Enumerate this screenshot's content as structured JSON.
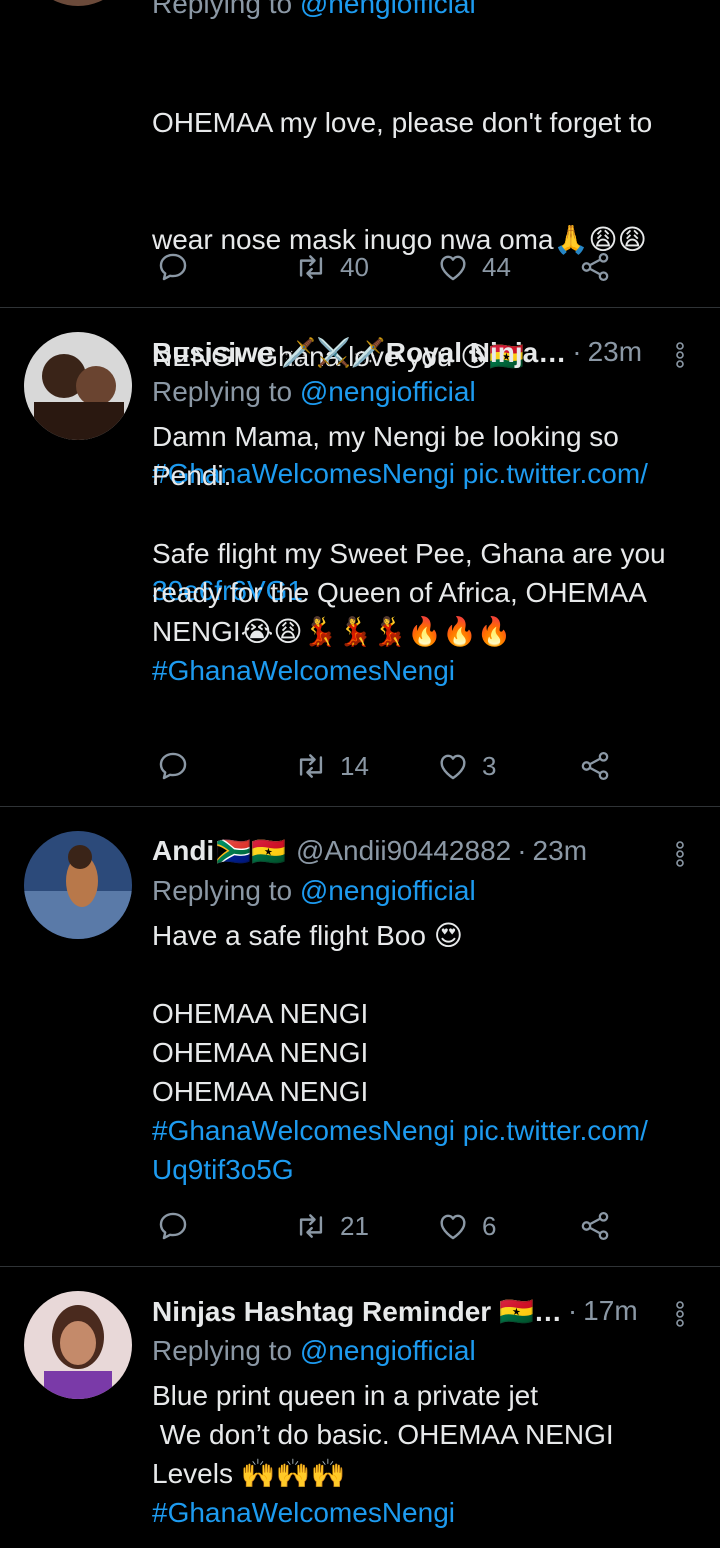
{
  "tweets": [
    {
      "reply_prefix": "Replying to ",
      "reply_handle": "@nengiofficial",
      "line1": "OHEMAA my love, please don't forget to",
      "line2": "wear nose mask inugo nwa oma🙏😩😩",
      "line3": "NENGI  Ghana love you 😘🇬🇭",
      "line4": "#GhanaWelcomesNengi pic.twitter.com/",
      "line5": "30e6fr6VG1",
      "retweets": "40",
      "likes": "44"
    },
    {
      "name": "Busisiwe 🗡️⚔️🗡️Royal Ninja…",
      "time": "23m",
      "reply_prefix": "Replying to ",
      "reply_handle": "@nengiofficial",
      "body": "Damn Mama, my Nengi be looking so\nPendi.\n\nSafe flight my Sweet Pee, Ghana are you\nready for the Queen of Africa, OHEMAA\nNENGI😭😩💃💃💃🔥🔥🔥\n",
      "hashtag": "#GhanaWelcomesNengi",
      "retweets": "14",
      "likes": "3"
    },
    {
      "name": "Andi",
      "flags": "🇿🇦🇬🇭",
      "handle": "@Andii90442882",
      "time": "23m",
      "reply_prefix": "Replying to ",
      "reply_handle": "@nengiofficial",
      "body": "Have a safe flight Boo 😍\n\nOHEMAA NENGI\nOHEMAA NENGI\nOHEMAA NENGI",
      "link1": "#GhanaWelcomesNengi pic.twitter.com/",
      "link2": "Uq9tif3o5G",
      "retweets": "21",
      "likes": "6"
    },
    {
      "name": "Ninjas Hashtag Reminder 🇬🇭…",
      "time": "17m",
      "reply_prefix": "Replying to ",
      "reply_handle": "@nengiofficial",
      "body": "Blue print queen in a private jet\n We don’t do basic. OHEMAA NENGI\nLevels 🙌🙌🙌\n",
      "hashtag": "#GhanaWelcomesNengi"
    }
  ],
  "colors": {
    "background": "#000000",
    "text": "#e7e9ea",
    "muted": "#8b98a5",
    "link": "#1d9bf0",
    "divider": "#2f3336"
  },
  "icons": [
    "reply-icon",
    "retweet-icon",
    "like-icon",
    "share-icon",
    "more-options-icon"
  ]
}
